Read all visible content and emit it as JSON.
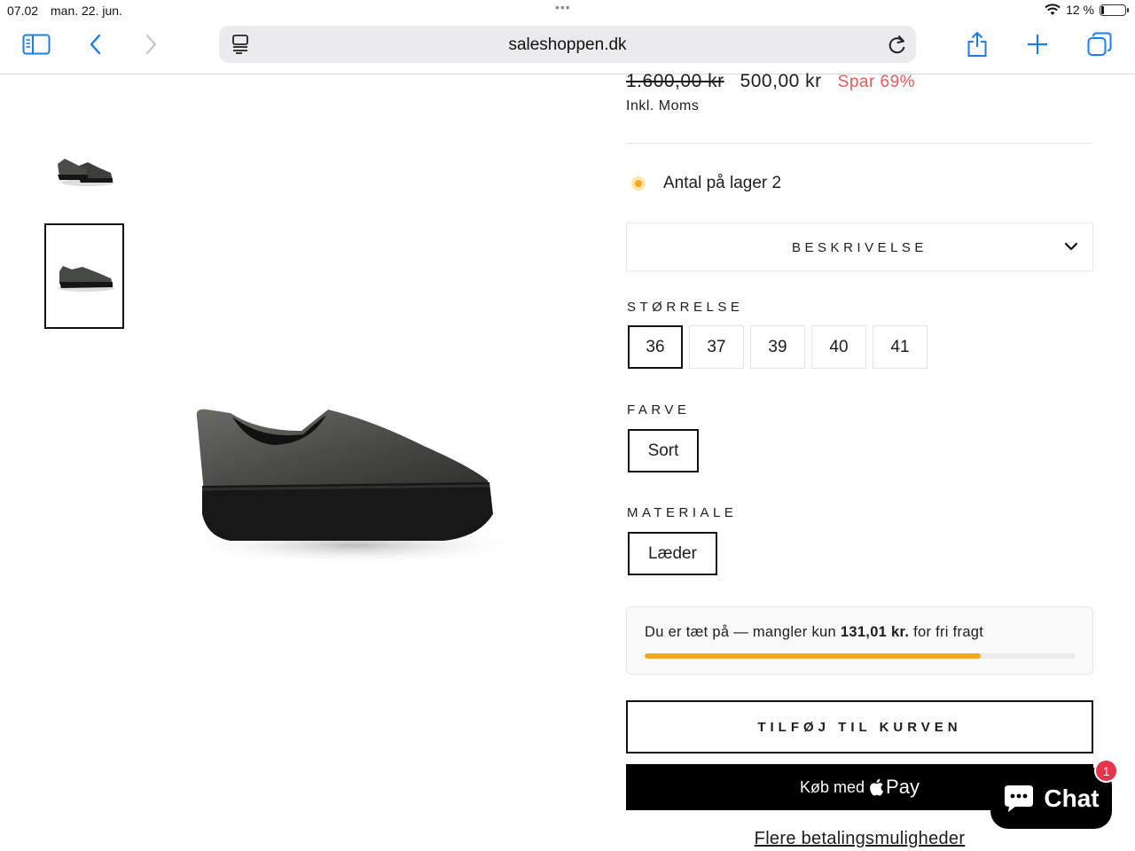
{
  "status_bar": {
    "time": "07.02",
    "date": "man. 22. jun.",
    "battery": "12 %"
  },
  "browser": {
    "url": "saleshoppen.dk",
    "icons": [
      "sidebar-icon",
      "back-icon",
      "forward-icon",
      "reader-icon",
      "reload-icon",
      "share-icon",
      "new-tab-icon",
      "tabs-icon"
    ]
  },
  "product": {
    "price_old": "1.600,00 kr",
    "price_new": "500,00 kr",
    "discount": "Spar 69%",
    "tax_note": "Inkl. Moms",
    "stock": "Antal på lager 2",
    "description_label": "BESKRIVELSE",
    "size": {
      "label": "STØRRELSE",
      "options": [
        "36",
        "37",
        "39",
        "40",
        "41"
      ],
      "selected": "36"
    },
    "color": {
      "label": "FARVE",
      "value": "Sort"
    },
    "material": {
      "label": "MATERIALE",
      "value": "Læder"
    }
  },
  "shipping": {
    "text_before": "Du er tæt på — mangler kun ",
    "amount": "131,01 kr.",
    "text_after": " for fri fragt",
    "progress": 0.78
  },
  "actions": {
    "add_to_cart": "TILFØJ TIL KURVEN",
    "apple_pay_prefix": "Køb med",
    "apple_pay_word": "Pay",
    "more_payments": "Flere betalingsmuligheder"
  },
  "chat": {
    "label": "Chat",
    "badge": "1"
  },
  "colors": {
    "accent": "#f2a920",
    "sale": "#e35b5b",
    "chat_badge": "#e8344a",
    "safari_blue": "#1a7cf5"
  }
}
